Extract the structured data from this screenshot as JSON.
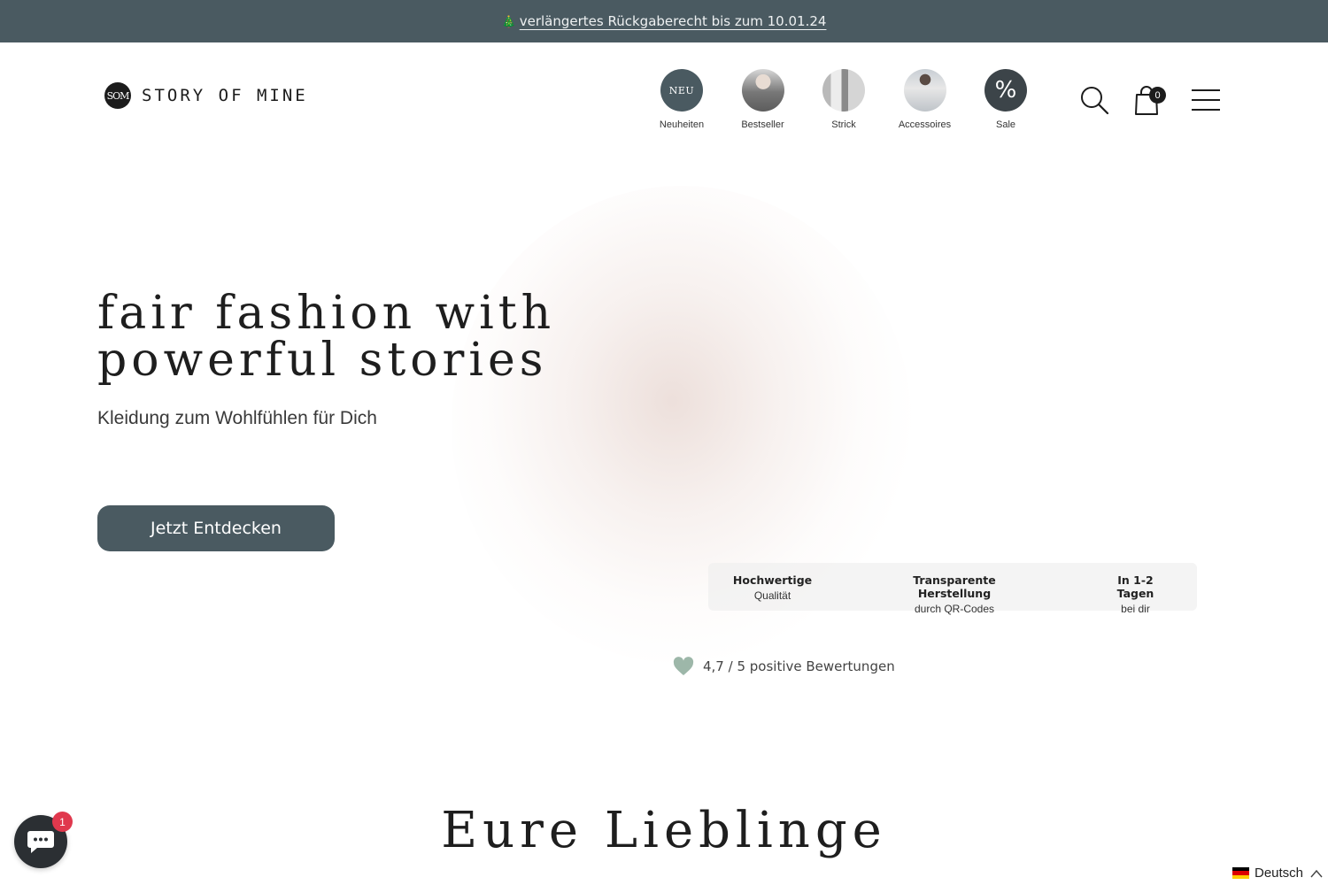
{
  "announcement": {
    "icon": "christmas-tree-icon",
    "text": "verlängertes Rückgaberecht bis zum 10.01.24",
    "bg_color": "#4a5a61"
  },
  "header": {
    "logo_mark": "SOM",
    "logo_text": "STORY OF MINE",
    "categories": [
      {
        "label": "Neuheiten",
        "badge": "NEU"
      },
      {
        "label": "Bestseller"
      },
      {
        "label": "Strick"
      },
      {
        "label": "Accessoires"
      },
      {
        "label": "Sale",
        "badge": "%"
      }
    ],
    "cart_count": "0",
    "icons": [
      "search-icon",
      "shopping-bag-icon",
      "hamburger-menu-icon"
    ]
  },
  "hero": {
    "title_line1": "fair fashion with",
    "title_line2": "powerful stories",
    "subtitle": "Kleidung zum Wohlfühlen für Dich",
    "cta_label": "Jetzt Entdecken",
    "usps": [
      {
        "title": "Hochwertige",
        "sub": "Qualität"
      },
      {
        "title": "Transparente Herstellung",
        "sub": "durch QR-Codes"
      },
      {
        "title": "In 1-2 Tagen",
        "sub": "bei dir"
      }
    ],
    "rating_text": "4,7 / 5 positive Bewertungen",
    "accent_color": "#4a5a61"
  },
  "section": {
    "title": "Eure Lieblinge"
  },
  "chat": {
    "badge": "1"
  },
  "language": {
    "label": "Deutsch"
  }
}
